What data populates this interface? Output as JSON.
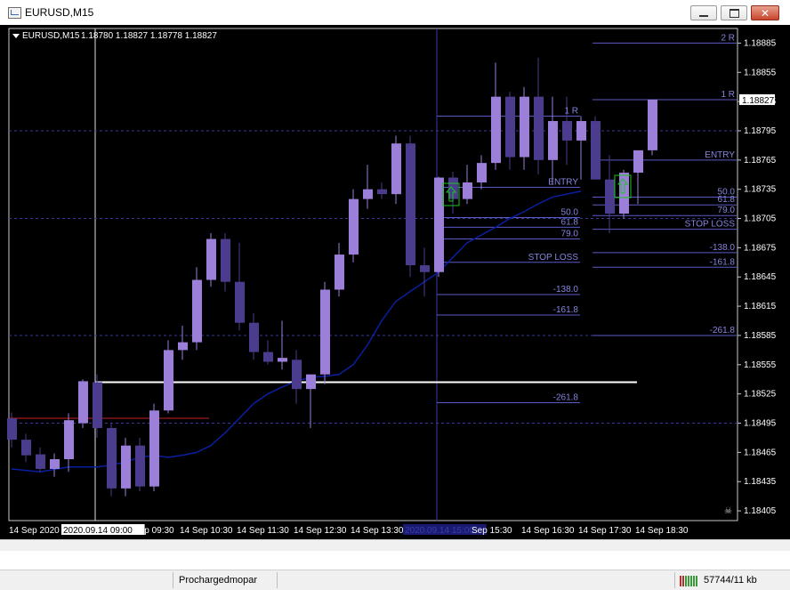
{
  "window": {
    "title": "EURUSD,M15",
    "minimize_glyph": "",
    "maximize_glyph": "",
    "close_glyph": "✕"
  },
  "chart_header": {
    "symbol": "EURUSD,M15",
    "ohlc": "1.18780 1.18827 1.18778 1.18827"
  },
  "colors": {
    "background": "#000000",
    "bull": "#9b7fd9",
    "bear": "#4b3c8e",
    "ma": "#0a1fa0",
    "level_line": "#5a5ac8",
    "label": "#8585e0",
    "price_tag_bg": "#ffffff",
    "white_line": "#ffffff",
    "red_line": "#cc2222",
    "arrow": "#18c918"
  },
  "chart_data": {
    "type": "candlestick",
    "symbol": "EURUSD",
    "timeframe": "M15",
    "current_price": "1.18827",
    "price_axis_ticks": [
      "1.18885",
      "1.18855",
      "1.18825",
      "1.18795",
      "1.18765",
      "1.18735",
      "1.18705",
      "1.18675",
      "1.18645",
      "1.18615",
      "1.18585",
      "1.18555",
      "1.18525",
      "1.18495",
      "1.18465",
      "1.18435",
      "1.18405"
    ],
    "time_axis_ticks": [
      "14 Sep 2020",
      "2020.09.14 09:00",
      "Sep 09:30",
      "14 Sep 10:30",
      "14 Sep 11:30",
      "14 Sep 12:30",
      "14 Sep 13:30",
      "2020.09.14 15:00",
      "Sep 15:30",
      "14 Sep 16:30",
      "14 Sep 17:30",
      "14 Sep 18:30"
    ],
    "candles": [
      {
        "o": 1.185,
        "h": 1.18506,
        "l": 1.1847,
        "c": 1.18478
      },
      {
        "o": 1.18478,
        "h": 1.18484,
        "l": 1.18455,
        "c": 1.18462
      },
      {
        "o": 1.18463,
        "h": 1.1847,
        "l": 1.18445,
        "c": 1.18448
      },
      {
        "o": 1.18448,
        "h": 1.18464,
        "l": 1.1844,
        "c": 1.18458
      },
      {
        "o": 1.18458,
        "h": 1.18505,
        "l": 1.18445,
        "c": 1.18498
      },
      {
        "o": 1.18495,
        "h": 1.1854,
        "l": 1.1849,
        "c": 1.18538
      },
      {
        "o": 1.18537,
        "h": 1.18545,
        "l": 1.1848,
        "c": 1.1849
      },
      {
        "o": 1.1849,
        "h": 1.18495,
        "l": 1.1842,
        "c": 1.18428
      },
      {
        "o": 1.18428,
        "h": 1.1848,
        "l": 1.1842,
        "c": 1.18472
      },
      {
        "o": 1.18472,
        "h": 1.1848,
        "l": 1.18425,
        "c": 1.1843
      },
      {
        "o": 1.1843,
        "h": 1.18515,
        "l": 1.18425,
        "c": 1.18508
      },
      {
        "o": 1.18508,
        "h": 1.1858,
        "l": 1.18505,
        "c": 1.1857
      },
      {
        "o": 1.1857,
        "h": 1.18595,
        "l": 1.1856,
        "c": 1.18578
      },
      {
        "o": 1.18578,
        "h": 1.18655,
        "l": 1.1857,
        "c": 1.18642
      },
      {
        "o": 1.18642,
        "h": 1.1869,
        "l": 1.18635,
        "c": 1.18684
      },
      {
        "o": 1.18684,
        "h": 1.1869,
        "l": 1.1863,
        "c": 1.1864
      },
      {
        "o": 1.1864,
        "h": 1.1868,
        "l": 1.1859,
        "c": 1.18598
      },
      {
        "o": 1.18598,
        "h": 1.18608,
        "l": 1.1856,
        "c": 1.18568
      },
      {
        "o": 1.18568,
        "h": 1.1858,
        "l": 1.18555,
        "c": 1.18558
      },
      {
        "o": 1.18558,
        "h": 1.186,
        "l": 1.1855,
        "c": 1.18562
      },
      {
        "o": 1.1856,
        "h": 1.1857,
        "l": 1.18515,
        "c": 1.1853
      },
      {
        "o": 1.1853,
        "h": 1.18545,
        "l": 1.1849,
        "c": 1.18545
      },
      {
        "o": 1.18545,
        "h": 1.1864,
        "l": 1.18535,
        "c": 1.18632
      },
      {
        "o": 1.18632,
        "h": 1.1868,
        "l": 1.18625,
        "c": 1.18668
      },
      {
        "o": 1.18668,
        "h": 1.18735,
        "l": 1.1866,
        "c": 1.18725
      },
      {
        "o": 1.18725,
        "h": 1.1876,
        "l": 1.18715,
        "c": 1.18735
      },
      {
        "o": 1.18735,
        "h": 1.18742,
        "l": 1.18725,
        "c": 1.1873
      },
      {
        "o": 1.1873,
        "h": 1.1879,
        "l": 1.1872,
        "c": 1.18782
      },
      {
        "o": 1.18782,
        "h": 1.1879,
        "l": 1.18645,
        "c": 1.18657
      },
      {
        "o": 1.18657,
        "h": 1.18675,
        "l": 1.18625,
        "c": 1.1865
      },
      {
        "o": 1.1865,
        "h": 1.18748,
        "l": 1.18645,
        "c": 1.18747
      },
      {
        "o": 1.18747,
        "h": 1.18753,
        "l": 1.1871,
        "c": 1.18725
      },
      {
        "o": 1.18725,
        "h": 1.1876,
        "l": 1.1872,
        "c": 1.18742
      },
      {
        "o": 1.18742,
        "h": 1.1877,
        "l": 1.18735,
        "c": 1.18762
      },
      {
        "o": 1.18762,
        "h": 1.18865,
        "l": 1.18755,
        "c": 1.1883
      },
      {
        "o": 1.1883,
        "h": 1.18835,
        "l": 1.18755,
        "c": 1.18768
      },
      {
        "o": 1.18768,
        "h": 1.1884,
        "l": 1.18755,
        "c": 1.1883
      },
      {
        "o": 1.1883,
        "h": 1.1887,
        "l": 1.1875,
        "c": 1.18765
      },
      {
        "o": 1.18765,
        "h": 1.1883,
        "l": 1.1874,
        "c": 1.18805
      },
      {
        "o": 1.18805,
        "h": 1.1883,
        "l": 1.1876,
        "c": 1.18785
      },
      {
        "o": 1.18785,
        "h": 1.1881,
        "l": 1.18745,
        "c": 1.18805
      },
      {
        "o": 1.18805,
        "h": 1.1881,
        "l": 1.18765,
        "c": 1.18745
      },
      {
        "o": 1.18745,
        "h": 1.1877,
        "l": 1.1869,
        "c": 1.1871
      },
      {
        "o": 1.1871,
        "h": 1.18755,
        "l": 1.18705,
        "c": 1.18752
      },
      {
        "o": 1.18752,
        "h": 1.18765,
        "l": 1.1872,
        "c": 1.18775
      },
      {
        "o": 1.18775,
        "h": 1.188,
        "l": 1.1877,
        "c": 1.18827
      }
    ],
    "moving_average": [
      1.1845,
      1.1845,
      1.18452,
      1.18455,
      1.1846,
      1.18462,
      1.1846,
      1.18462,
      1.18465,
      1.18472,
      1.18485,
      1.185,
      1.18515,
      1.18525,
      1.18532,
      1.18538,
      1.18542,
      1.18543,
      1.18545,
      1.18555,
      1.18575,
      1.186,
      1.1862,
      1.1863,
      1.1864,
      1.1865,
      1.18665,
      1.1868,
      1.18688,
      1.18696,
      1.18705,
      1.18712,
      1.1872,
      1.18727,
      1.1873,
      1.18733
    ],
    "first_fibo": {
      "levels": [
        {
          "label": "1  R",
          "price": 1.1881
        },
        {
          "label": "ENTRY",
          "price": 1.18737
        },
        {
          "label": "50.0",
          "price": 1.18706
        },
        {
          "label": "61.8",
          "price": 1.18696
        },
        {
          "label": "79.0",
          "price": 1.18684
        },
        {
          "label": "STOP LOSS",
          "price": 1.1866
        },
        {
          "label": "-138.0",
          "price": 1.18627
        },
        {
          "label": "-161.8",
          "price": 1.18606
        },
        {
          "label": "-261.8",
          "price": 1.18516
        }
      ]
    },
    "second_fibo": {
      "levels": [
        {
          "label": "2  R",
          "price": 1.18885
        },
        {
          "label": "1  R",
          "price": 1.18827
        },
        {
          "label": "ENTRY",
          "price": 1.18765
        },
        {
          "label": "50.0",
          "price": 1.18727
        },
        {
          "label": "61.8",
          "price": 1.18719
        },
        {
          "label": "79.0",
          "price": 1.18708
        },
        {
          "label": "STOP LOSS",
          "price": 1.18694
        },
        {
          "label": "-138.0",
          "price": 1.1867
        },
        {
          "label": "-161.8",
          "price": 1.18655
        },
        {
          "label": "-261.8",
          "price": 1.18585
        }
      ]
    },
    "horizontal_lines": [
      {
        "name": "white-support",
        "price": 1.18537
      },
      {
        "name": "red-level",
        "price": 1.185
      }
    ]
  },
  "statusbar": {
    "profile": "Prochargedmopar",
    "traffic": "57744/11 kb"
  }
}
